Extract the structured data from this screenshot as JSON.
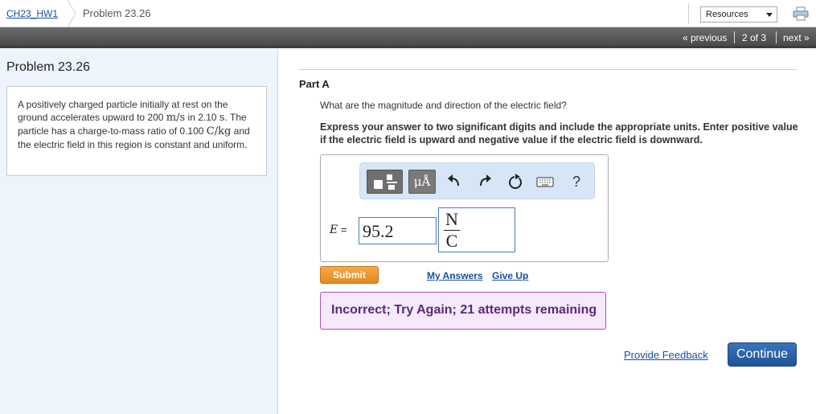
{
  "breadcrumb": {
    "home": "CH23_HW1",
    "current": "Problem 23.26"
  },
  "resources": {
    "label": "Resources"
  },
  "icons": {
    "print": "printer-icon",
    "caret": "chevron-down-icon"
  },
  "nav": {
    "previous": "« previous",
    "position": "2 of 3",
    "next": "next »"
  },
  "left": {
    "title": "Problem 23.26",
    "problem_parts": [
      "A positively charged particle initially at rest on the ground accelerates upward to 200 ",
      "m/s",
      " in 2.10 ",
      "s",
      ". The particle has a charge-to-mass ratio of 0.100 ",
      "C/kg",
      " and the electric field in this region is constant and uniform."
    ]
  },
  "part": {
    "label": "Part A",
    "question": "What are the magnitude and direction of the electric field?",
    "instruction": "Express your answer to two significant digits and include the appropriate units. Enter positive value if the electric field is upward and negative value if the electric field is downward."
  },
  "toolbar": {
    "units_label": "μÅ",
    "help_label": "?",
    "buttons": [
      "templates-icon",
      "units-icon",
      "undo-icon",
      "redo-icon",
      "reset-icon",
      "keyboard-icon",
      "help-icon"
    ]
  },
  "answer": {
    "variable": "E",
    "equals": " =",
    "value": "95.2",
    "unit_numerator": "N",
    "unit_denominator": "C"
  },
  "actions": {
    "submit": "Submit",
    "my_answers": "My Answers",
    "give_up": "Give Up"
  },
  "feedback": "Incorrect; Try Again; 21 attempts remaining",
  "footer": {
    "provide_feedback": "Provide Feedback",
    "continue": "Continue"
  },
  "colors": {
    "link": "#1a4fa3",
    "submit": "#e48a1c",
    "continue": "#1f5499",
    "feedback_border": "#a64fc4",
    "feedback_bg": "#f5e9fb",
    "left_panel_bg": "#eef4fb",
    "toolbar_bg": "#d6e6f6"
  }
}
